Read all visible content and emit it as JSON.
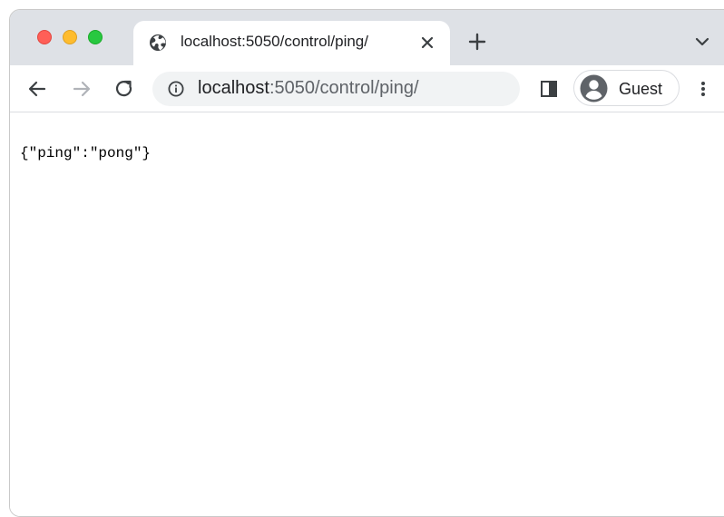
{
  "browser": {
    "tab": {
      "title": "localhost:5050/control/ping/"
    },
    "address_bar": {
      "host": "localhost",
      "path": ":5050/control/ping/"
    },
    "profile": {
      "label": "Guest"
    },
    "icons": {
      "favicon": "globe-icon",
      "tab_close": "close-icon",
      "new_tab": "plus-icon",
      "tab_search": "chevron-down-icon",
      "back": "arrow-left-icon",
      "forward": "arrow-right-icon",
      "reload": "reload-icon",
      "site_info": "info-icon",
      "side_panel": "side-panel-icon",
      "avatar": "account-circle-icon",
      "menu": "more-vert-icon"
    },
    "colors": {
      "tabstrip": "#dee1e6",
      "omnibox": "#f1f3f4",
      "close_button": "#ff5f57",
      "minimize_button": "#febc2e",
      "zoom_button": "#28c840"
    }
  },
  "page": {
    "body_text": "{\"ping\":\"pong\"}"
  }
}
